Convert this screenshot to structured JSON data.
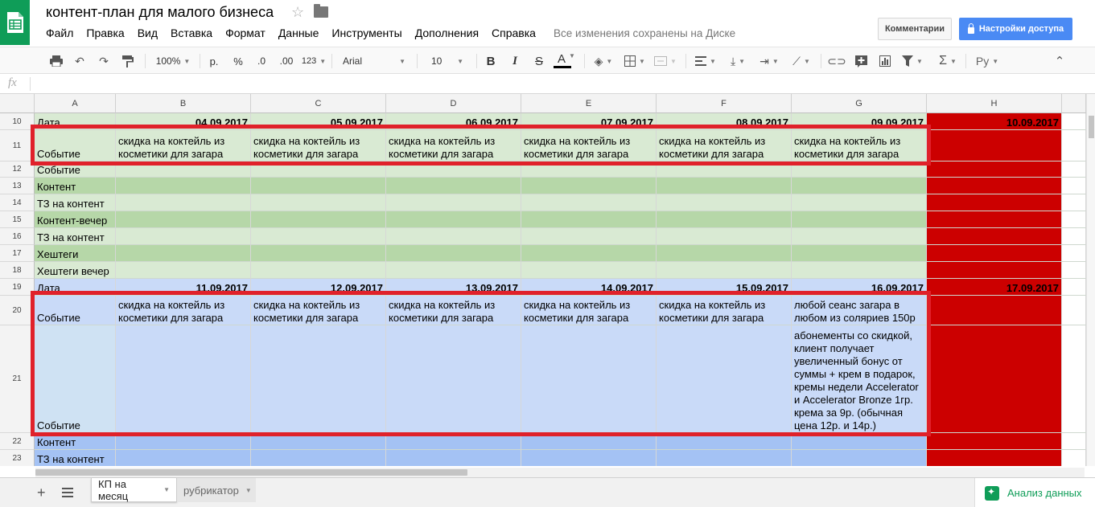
{
  "doc": {
    "title": "контент-план для малого бизнеса",
    "save_status": "Все изменения сохранены на Диске"
  },
  "menu": [
    "Файл",
    "Правка",
    "Вид",
    "Вставка",
    "Формат",
    "Данные",
    "Инструменты",
    "Дополнения",
    "Справка"
  ],
  "buttons": {
    "comments": "Комментарии",
    "share": "Настройки доступа"
  },
  "toolbar": {
    "zoom": "100%",
    "currency": "р.",
    "percent": "%",
    "dec_less": ".0",
    "dec_more": ".00",
    "format_more": "123",
    "font": "Arial",
    "font_size": "10",
    "bold": "B",
    "italic": "I",
    "strike": "S",
    "text_color": "A",
    "input_tools": "Ру"
  },
  "formula": {
    "fx": "fx",
    "value": ""
  },
  "columns": [
    "A",
    "B",
    "C",
    "D",
    "E",
    "F",
    "G",
    "H"
  ],
  "rows": [
    {
      "num": "10",
      "style": "g1",
      "cells": [
        "Дата",
        "04.09.2017",
        "05.09.2017",
        "06.09.2017",
        "07.09.2017",
        "08.09.2017",
        "09.09.2017",
        "10.09.2017"
      ]
    },
    {
      "num": "11",
      "style": "g1",
      "cells": [
        "Событие",
        "скидка на коктейль из косметики для загара",
        "скидка на коктейль из косметики для загара",
        "скидка на коктейль из косметики для загара",
        "скидка на коктейль из косметики для загара",
        "скидка на коктейль из косметики для загара",
        "скидка на коктейль из косметики для загара",
        ""
      ]
    },
    {
      "num": "12",
      "style": "g1",
      "cells": [
        "Событие",
        "",
        "",
        "",
        "",
        "",
        "",
        ""
      ]
    },
    {
      "num": "13",
      "style": "g2",
      "cells": [
        "Контент",
        "",
        "",
        "",
        "",
        "",
        "",
        ""
      ]
    },
    {
      "num": "14",
      "style": "g1",
      "cells": [
        "ТЗ на контент",
        "",
        "",
        "",
        "",
        "",
        "",
        ""
      ]
    },
    {
      "num": "15",
      "style": "g2",
      "cells": [
        "Контент-вечер",
        "",
        "",
        "",
        "",
        "",
        "",
        ""
      ]
    },
    {
      "num": "16",
      "style": "g1",
      "cells": [
        "ТЗ на контент",
        "",
        "",
        "",
        "",
        "",
        "",
        ""
      ]
    },
    {
      "num": "17",
      "style": "g2",
      "cells": [
        "Хештеги",
        "",
        "",
        "",
        "",
        "",
        "",
        ""
      ]
    },
    {
      "num": "18",
      "style": "g1",
      "cells": [
        "Хештеги вечер",
        "",
        "",
        "",
        "",
        "",
        "",
        ""
      ]
    },
    {
      "num": "19",
      "style": "b1",
      "cells": [
        "Дата",
        "11.09.2017",
        "12.09.2017",
        "13.09.2017",
        "14.09.2017",
        "15.09.2017",
        "16.09.2017",
        "17.09.2017"
      ]
    },
    {
      "num": "20",
      "style": "b1",
      "cells": [
        "Событие",
        "скидка на коктейль из косметики для загара",
        "скидка на коктейль из косметики для загара",
        "скидка на коктейль из косметики для загара",
        "скидка на коктейль из косметики для загара",
        "скидка на коктейль из косметики для загара",
        "любой сеанс загара в любом из соляриев 150р",
        ""
      ]
    },
    {
      "num": "21",
      "style": "b1",
      "cells": [
        "Событие",
        "",
        "",
        "",
        "",
        "",
        "абонементы со скидкой, клиент получает увеличенный бонус от суммы + крем в подарок, кремы недели Accelerator и Accelerator Bronze 1гр. крема за 9р. (обычная цена 12р. и 14р.)",
        ""
      ]
    },
    {
      "num": "22",
      "style": "b2",
      "cells": [
        "Контент",
        "",
        "",
        "",
        "",
        "",
        "",
        ""
      ]
    },
    {
      "num": "23",
      "style": "b2",
      "cells": [
        "ТЗ на контент",
        "",
        "",
        "",
        "",
        "",
        "",
        ""
      ]
    }
  ],
  "sheets": {
    "active": "КП на месяц",
    "other": "рубрикатор"
  },
  "explore": "Анализ данных",
  "colors": {
    "green_light": "#d9ead3",
    "green_dark": "#b6d7a8",
    "blue_light": "#c9daf8",
    "blue_dark": "#a4c2f4",
    "red": "#cc0000",
    "highlight": "#e0212a",
    "brand": "#0f9d58",
    "share": "#4a8af4"
  }
}
